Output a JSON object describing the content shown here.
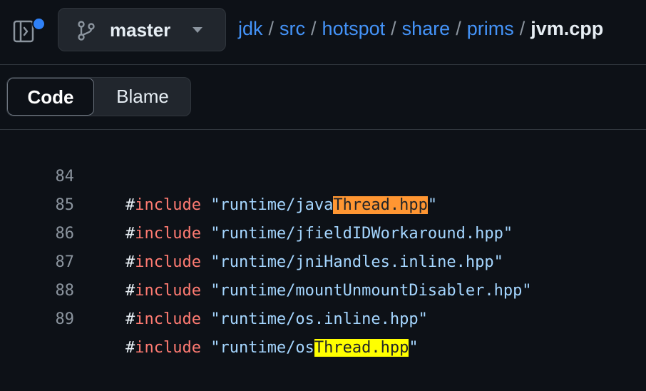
{
  "header": {
    "sidebar_toggle_icon": "sidebar-expand-icon",
    "branch": {
      "icon": "git-branch-icon",
      "name": "master"
    },
    "breadcrumb": {
      "items": [
        "jdk",
        "src",
        "hotspot",
        "share",
        "prims"
      ],
      "separator": "/",
      "current": "jvm.cpp"
    }
  },
  "tabs": {
    "code": "Code",
    "blame": "Blame",
    "selected": "Code"
  },
  "code": {
    "lines": [
      {
        "number": "84",
        "hash": "#",
        "keyword": "include",
        "pre": "\"runtime/java",
        "highlight": "Thread.hpp",
        "post": "\"",
        "highlight_color": "#ff9632"
      },
      {
        "number": "85",
        "hash": "#",
        "keyword": "include",
        "pre": "\"runtime/jfieldIDWorkaround.hpp\"",
        "highlight": "",
        "post": ""
      },
      {
        "number": "86",
        "hash": "#",
        "keyword": "include",
        "pre": "\"runtime/jniHandles.inline.hpp\"",
        "highlight": "",
        "post": ""
      },
      {
        "number": "87",
        "hash": "#",
        "keyword": "include",
        "pre": "\"runtime/mountUnmountDisabler.hpp\"",
        "highlight": "",
        "post": ""
      },
      {
        "number": "88",
        "hash": "#",
        "keyword": "include",
        "pre": "\"runtime/os.inline.hpp\"",
        "highlight": "",
        "post": ""
      },
      {
        "number": "89",
        "hash": "#",
        "keyword": "include",
        "pre": "\"runtime/os",
        "highlight": "Thread.hpp",
        "post": "\"",
        "highlight_color": "#ffff00"
      }
    ]
  },
  "colors": {
    "background": "#0d1117",
    "link": "#4493f8",
    "keyword": "#ff7b72",
    "string": "#a5d6ff",
    "current_match": "#ff9632",
    "match": "#ffff00"
  }
}
